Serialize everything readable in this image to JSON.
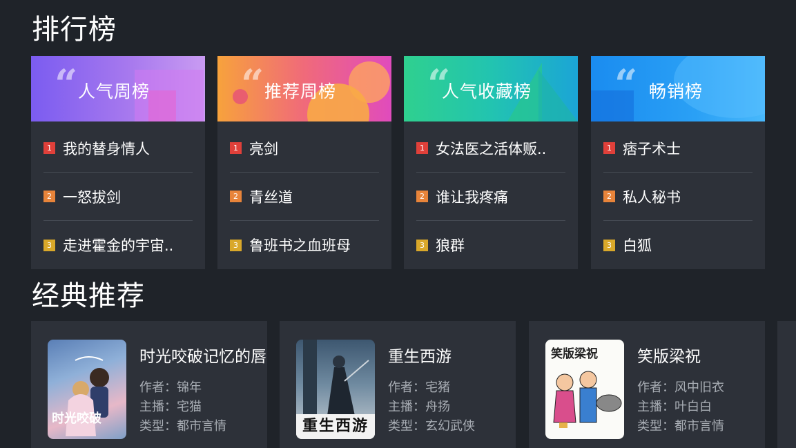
{
  "sections": {
    "rank_title": "排行榜",
    "classic_title": "经典推荐"
  },
  "quote_glyph": "“",
  "rank_lists": [
    {
      "title": "人气周榜",
      "items": [
        {
          "badge": "1",
          "name": "我的替身情人"
        },
        {
          "badge": "2",
          "name": "一怒拔剑"
        },
        {
          "badge": "3",
          "name": "走进霍金的宇宙.."
        }
      ]
    },
    {
      "title": "推荐周榜",
      "items": [
        {
          "badge": "1",
          "name": "亮剑"
        },
        {
          "badge": "2",
          "name": "青丝道"
        },
        {
          "badge": "3",
          "name": "鲁班书之血班母"
        }
      ]
    },
    {
      "title": "人气收藏榜",
      "items": [
        {
          "badge": "1",
          "name": "女法医之活体贩.."
        },
        {
          "badge": "2",
          "name": "谁让我疼痛"
        },
        {
          "badge": "3",
          "name": "狼群"
        }
      ]
    },
    {
      "title": "畅销榜",
      "items": [
        {
          "badge": "1",
          "name": "痞子术士"
        },
        {
          "badge": "2",
          "name": "私人秘书"
        },
        {
          "badge": "3",
          "name": "白狐"
        }
      ]
    }
  ],
  "books": [
    {
      "title": "时光咬破记忆的唇",
      "author_label": "作者：",
      "author": "锦年",
      "narrator_label": "主播：",
      "narrator": "宅猫",
      "genre_label": "类型：",
      "genre": "都市言情",
      "cover_text": "时光咬破"
    },
    {
      "title": "重生西游",
      "author_label": "作者：",
      "author": "宅猪",
      "narrator_label": "主播：",
      "narrator": "舟扬",
      "genre_label": "类型：",
      "genre": "玄幻武侠",
      "cover_text": "重生西游"
    },
    {
      "title": "笑版梁祝",
      "author_label": "作者：",
      "author": "风中旧衣",
      "narrator_label": "主播：",
      "narrator": "叶白白",
      "genre_label": "类型：",
      "genre": "都市言情",
      "cover_text": "笑版梁祝"
    }
  ],
  "colors": {
    "background": "#1f2329",
    "card": "#2d3139",
    "badge1": "#e0403a",
    "badge2": "#e8843a",
    "badge3": "#d9a82a"
  }
}
